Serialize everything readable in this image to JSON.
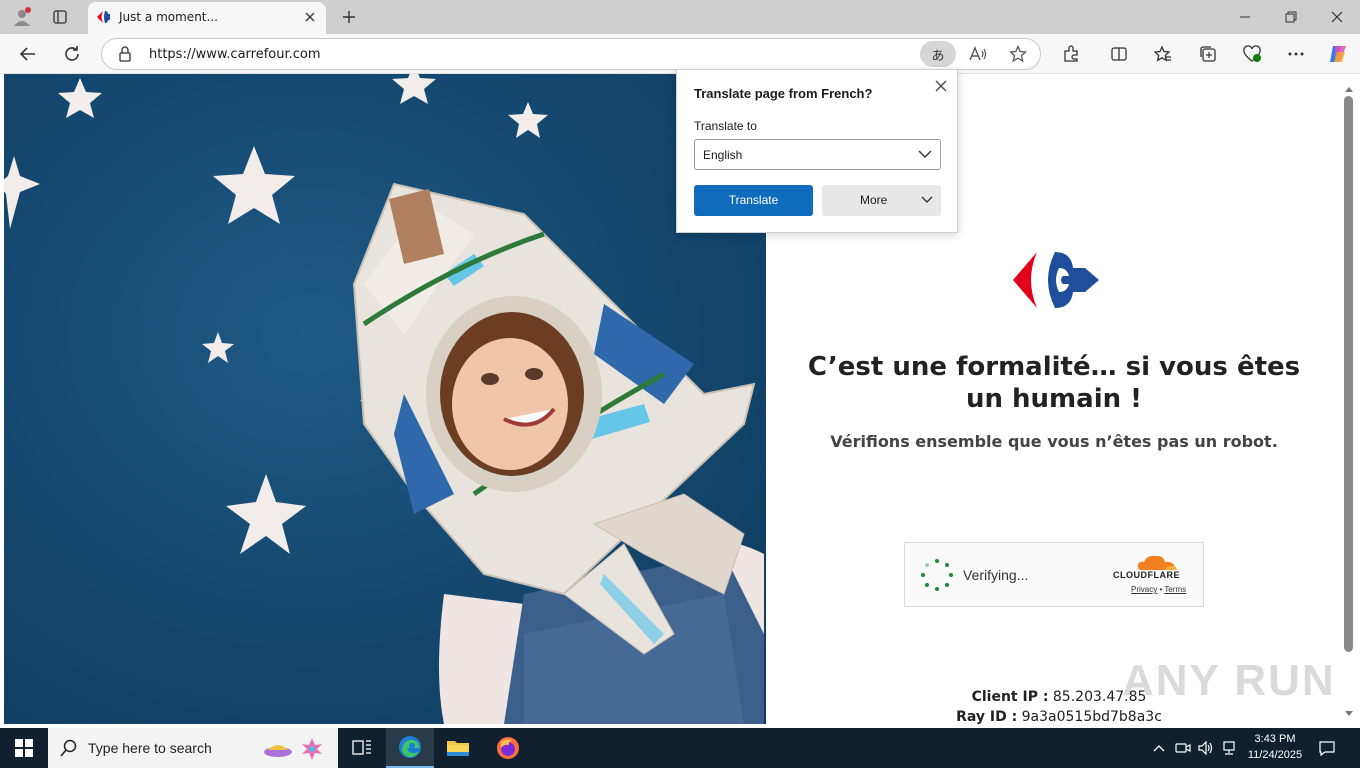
{
  "browser": {
    "tab_title": "Just a moment...",
    "url": "https://www.carrefour.com",
    "translate_icon_label": "あ"
  },
  "translate_popup": {
    "title": "Translate page from French?",
    "label": "Translate to",
    "selected_language": "English",
    "translate_button": "Translate",
    "more_button": "More"
  },
  "page": {
    "headline_line1": "C’est une formalité… si vous êtes",
    "headline_line2": "un humain !",
    "subline": "Vérifions ensemble que vous n’êtes pas un robot.",
    "captcha": {
      "status": "Verifying...",
      "brand": "CLOUDFLARE",
      "privacy": "Privacy",
      "separator": "•",
      "terms": "Terms"
    },
    "client_ip_label": "Client IP :",
    "client_ip": "85.203.47.85",
    "ray_id_label": "Ray ID :",
    "ray_id": "9a3a0515bd7b8a3c",
    "watermark": "ANY RUN"
  },
  "taskbar": {
    "search_placeholder": "Type here to search",
    "time": "3:43 PM",
    "date": "11/24/2025"
  },
  "colors": {
    "accent": "#0f6cbd",
    "carrefour_red": "#e2001a",
    "carrefour_blue": "#1e4e9c",
    "cloudflare_orange": "#f38020",
    "taskbar": "#10202e"
  }
}
